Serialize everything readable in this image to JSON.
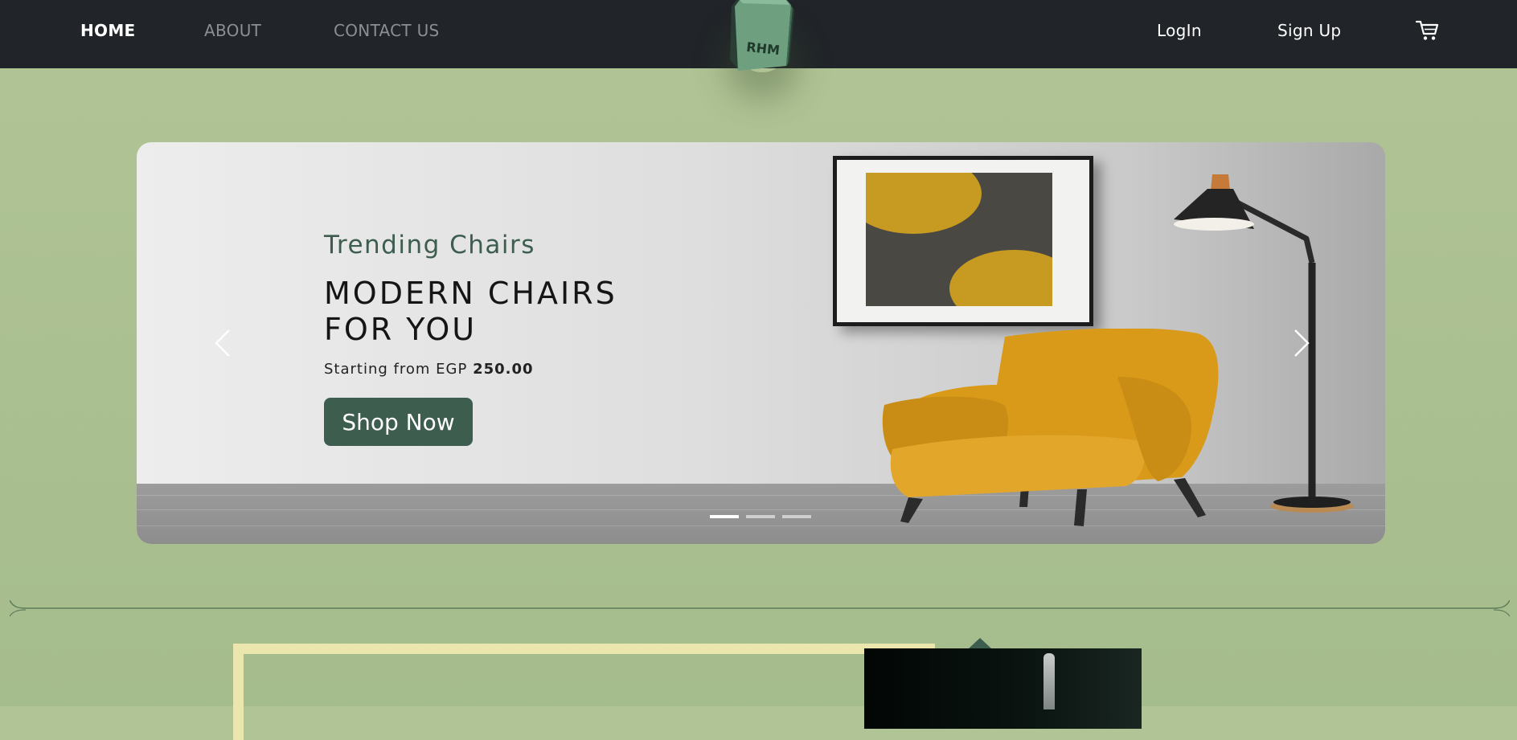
{
  "nav": {
    "links": [
      "HOME",
      "ABOUT",
      "CONTACT US"
    ],
    "logo_text": "RHM",
    "login_label": "LogIn",
    "signup_label": "Sign Up",
    "cart_icon": "cart-icon"
  },
  "hero": {
    "subtitle": "Trending Chairs",
    "title_line1": "MODERN CHAIRS",
    "title_line2": "FOR YOU",
    "price_prefix": "Starting from EGP",
    "price_value": "250.00",
    "cta_label": "Shop Now",
    "prev_icon": "chevron-left-icon",
    "next_icon": "chevron-right-icon",
    "slide_count": 3,
    "active_slide": 1
  },
  "colors": {
    "navbar_bg": "#212529",
    "page_bg": "#a9bf8f",
    "accent_green": "#3d5d4f",
    "chair_yellow": "#d99a1a",
    "cream_border": "#ebe6ad"
  }
}
